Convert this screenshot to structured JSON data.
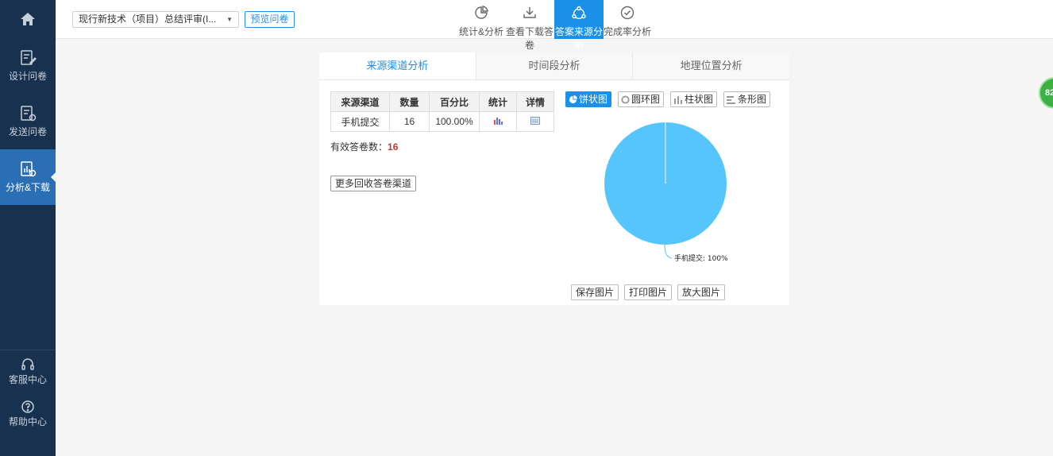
{
  "sidebar": {
    "items": [
      {
        "label": "设计问卷",
        "icon": "edit-doc-icon"
      },
      {
        "label": "发送问卷",
        "icon": "send-doc-icon"
      },
      {
        "label": "分析&下载",
        "icon": "chart-doc-icon"
      }
    ],
    "bottom": [
      {
        "label": "客服中心",
        "icon": "headset-icon"
      },
      {
        "label": "帮助中心",
        "icon": "question-icon"
      }
    ]
  },
  "topbar": {
    "survey_select": "现行新技术（项目）总结评审(I...",
    "preview_label": "预览问卷",
    "tabs": [
      {
        "label": "统计&分析",
        "icon": "pie-chart-icon"
      },
      {
        "label": "查看下载答卷",
        "icon": "download-icon"
      },
      {
        "label": "答案来源分析",
        "icon": "share-icon"
      },
      {
        "label": "完成率分析",
        "icon": "check-circle-icon"
      }
    ]
  },
  "panel": {
    "subtabs": [
      "来源渠道分析",
      "时间段分析",
      "地理位置分析"
    ],
    "table": {
      "headers": [
        "来源渠道",
        "数量",
        "百分比",
        "统计",
        "详情"
      ],
      "rows": [
        {
          "channel": "手机提交",
          "count": "16",
          "percent": "100.00%"
        }
      ]
    },
    "valid_label": "有效答卷数：",
    "valid_value": "16",
    "more_label": "更多回收答卷渠道",
    "chart_types": [
      "饼状图",
      "圆环图",
      "柱状图",
      "条形图"
    ],
    "actions": [
      "保存图片",
      "打印图片",
      "放大图片"
    ]
  },
  "chart_data": {
    "type": "pie",
    "categories": [
      "手机提交"
    ],
    "values": [
      100
    ],
    "slice_labels": [
      "手机提交: 100%"
    ],
    "colors": [
      "#55c5fb"
    ]
  },
  "badge": "82"
}
